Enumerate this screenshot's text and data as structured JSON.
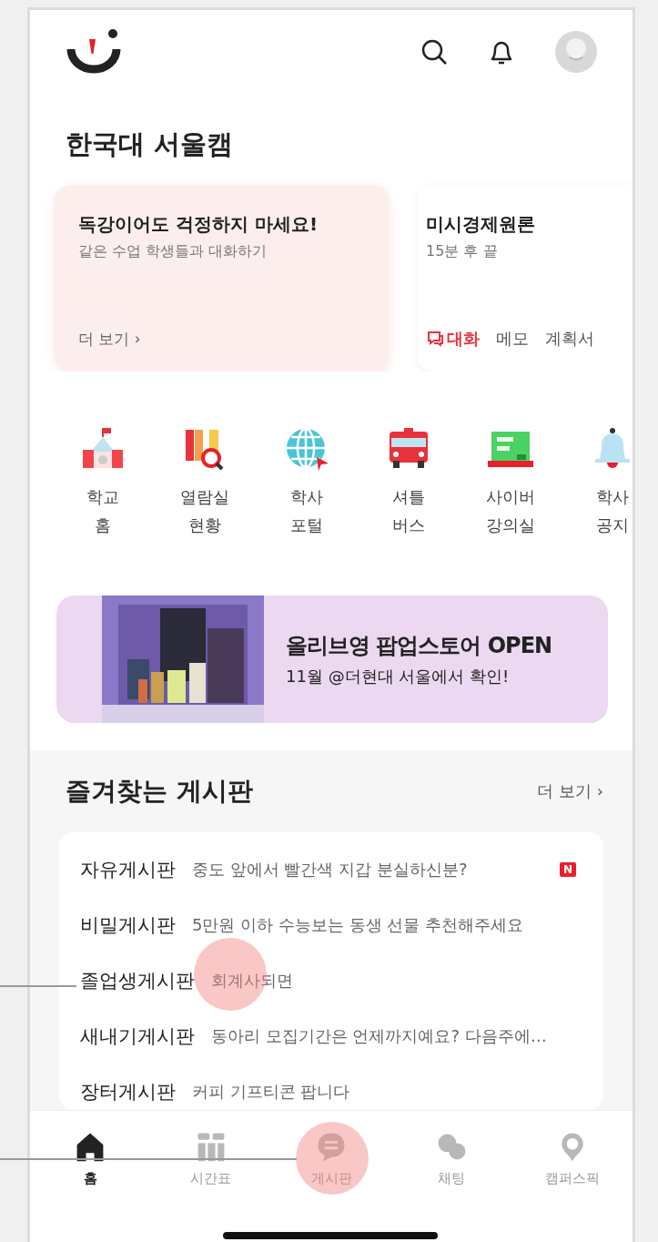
{
  "campus_title": "한국대 서울캠",
  "cards": [
    {
      "kind": "promo",
      "title": "독강이어도 걱정하지 마세요!",
      "subtitle": "같은 수업 학생들과 대화하기",
      "more": "더 보기 ›"
    },
    {
      "kind": "class",
      "title": "미시경제원론",
      "subtitle": "15분 후 끝",
      "actions": [
        {
          "label": "대화",
          "active": true
        },
        {
          "label": "메모",
          "active": false
        },
        {
          "label": "계획서",
          "active": false
        }
      ]
    }
  ],
  "shortcuts": [
    {
      "kind": "school",
      "label": "학교\n홈"
    },
    {
      "kind": "library",
      "label": "열람실\n현황"
    },
    {
      "kind": "portal",
      "label": "학사\n포털"
    },
    {
      "kind": "bus",
      "label": "셔틀\n버스"
    },
    {
      "kind": "cyber",
      "label": "사이버\n강의실"
    },
    {
      "kind": "notice",
      "label": "학사\n공지"
    }
  ],
  "banner": {
    "title": "올리브영 팝업스토어 OPEN",
    "subtitle": "11월 @더현대 서울에서 확인!"
  },
  "favorites": {
    "title": "즐겨찾는 게시판",
    "more": "더 보기 ›",
    "boards": [
      {
        "name": "자유게시판",
        "post": "중도 앞에서 빨간색 지갑 분실하신분?",
        "badge": "N"
      },
      {
        "name": "비밀게시판",
        "post": "5만원 이하 수능보는 동생 선물 추천해주세요"
      },
      {
        "name": "졸업생게시판",
        "post": "회계사되면"
      },
      {
        "name": "새내기게시판",
        "post": "동아리 모집기간은 언제까지예요? 다음주에…"
      },
      {
        "name": "장터게시판",
        "post": "커피 기프티콘 팝니다"
      }
    ]
  },
  "tabs": [
    {
      "kind": "home",
      "label": "홈",
      "selected": true
    },
    {
      "kind": "timetable",
      "label": "시간표",
      "selected": false
    },
    {
      "kind": "board",
      "label": "게시판",
      "selected": false
    },
    {
      "kind": "chat",
      "label": "채팅",
      "selected": false
    },
    {
      "kind": "pick",
      "label": "캠퍼스픽",
      "selected": false
    }
  ]
}
